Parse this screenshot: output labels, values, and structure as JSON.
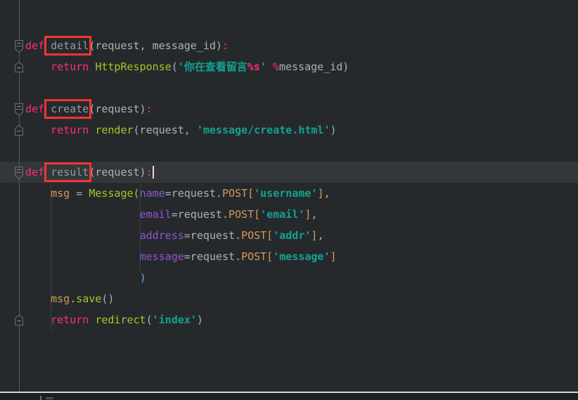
{
  "app": {
    "type": "code-editor",
    "description": "Dark-theme Python editor showing Django view functions with red annotation boxes"
  },
  "palette": {
    "background": "#26292c",
    "current_line_highlight": "#333739",
    "keyword_pink": "#fb2e77",
    "function_call_green": "#a3c724",
    "string_teal": "#12a391",
    "definition_name_grey": "#939ba1",
    "plain_text_grey": "#a9b2ba",
    "parameter_purple": "#9254d2",
    "property_orange": "#d79856",
    "paren_blue": "#6ba8e5",
    "annotation_box_red": "#f23434",
    "gutter_line_grey": "#56594f",
    "divider_light": "#d2d2d2"
  },
  "gutter": {
    "fold_icons": [
      {
        "line": 1,
        "icon": "fold-collapse-start-icon"
      },
      {
        "line": 2,
        "icon": "fold-collapse-end-icon"
      },
      {
        "line": 4,
        "icon": "fold-collapse-start-icon"
      },
      {
        "line": 5,
        "icon": "fold-collapse-end-icon"
      },
      {
        "line": 7,
        "icon": "fold-collapse-start-icon"
      },
      {
        "line": 14,
        "icon": "fold-collapse-end-icon"
      }
    ]
  },
  "annotations": {
    "red_boxed_words": [
      "detail",
      "create",
      "result"
    ],
    "caret_after_text": "def result(request):"
  },
  "code": {
    "language": "python",
    "lines": [
      {
        "tokens": [
          {
            "c": "kw",
            "t": "def"
          },
          {
            "c": "plain",
            "t": " "
          },
          {
            "c": "defname",
            "t": "detail"
          },
          {
            "c": "plain",
            "t": "(request, message_id)"
          },
          {
            "c": "kw",
            "t": ":"
          }
        ]
      },
      {
        "tokens": [
          {
            "c": "plain",
            "t": "    "
          },
          {
            "c": "kw",
            "t": "return"
          },
          {
            "c": "plain",
            "t": " "
          },
          {
            "c": "fn",
            "t": "HttpResponse"
          },
          {
            "c": "plain",
            "t": "("
          },
          {
            "c": "str",
            "t": "'你在查看留言"
          },
          {
            "c": "fmt",
            "t": "%s"
          },
          {
            "c": "str",
            "t": "'"
          },
          {
            "c": "plain",
            "t": " "
          },
          {
            "c": "kw",
            "t": "%"
          },
          {
            "c": "plain",
            "t": "message_id)"
          }
        ]
      },
      {
        "tokens": []
      },
      {
        "tokens": [
          {
            "c": "kw",
            "t": "def"
          },
          {
            "c": "plain",
            "t": " "
          },
          {
            "c": "defname",
            "t": "create"
          },
          {
            "c": "plain",
            "t": "(request)"
          },
          {
            "c": "kw",
            "t": ":"
          }
        ]
      },
      {
        "tokens": [
          {
            "c": "plain",
            "t": "    "
          },
          {
            "c": "kw",
            "t": "return"
          },
          {
            "c": "plain",
            "t": " "
          },
          {
            "c": "fn",
            "t": "render"
          },
          {
            "c": "plain",
            "t": "(request, "
          },
          {
            "c": "str",
            "t": "'message/create.html'"
          },
          {
            "c": "plain",
            "t": ")"
          }
        ]
      },
      {
        "tokens": []
      },
      {
        "tokens": [
          {
            "c": "kw",
            "t": "def"
          },
          {
            "c": "plain",
            "t": " "
          },
          {
            "c": "defname",
            "t": "result"
          },
          {
            "c": "plain",
            "t": "(request)"
          },
          {
            "c": "kw",
            "t": ":"
          }
        ]
      },
      {
        "tokens": [
          {
            "c": "plain",
            "t": "    "
          },
          {
            "c": "var",
            "t": "msg"
          },
          {
            "c": "plain",
            "t": " = "
          },
          {
            "c": "fn",
            "t": "Message("
          },
          {
            "c": "param",
            "t": "name"
          },
          {
            "c": "plain",
            "t": "=request."
          },
          {
            "c": "orange",
            "t": "POST["
          },
          {
            "c": "str",
            "t": "'username'"
          },
          {
            "c": "orange",
            "t": "]"
          },
          {
            "c": "plain",
            "t": ","
          }
        ]
      },
      {
        "tokens": [
          {
            "c": "plain",
            "t": "                  "
          },
          {
            "c": "param",
            "t": "email"
          },
          {
            "c": "plain",
            "t": "=request."
          },
          {
            "c": "orange",
            "t": "POST["
          },
          {
            "c": "str",
            "t": "'email'"
          },
          {
            "c": "orange",
            "t": "]"
          },
          {
            "c": "plain",
            "t": ","
          }
        ]
      },
      {
        "tokens": [
          {
            "c": "plain",
            "t": "                  "
          },
          {
            "c": "param",
            "t": "address"
          },
          {
            "c": "plain",
            "t": "=request."
          },
          {
            "c": "orange",
            "t": "POST["
          },
          {
            "c": "str",
            "t": "'addr'"
          },
          {
            "c": "orange",
            "t": "]"
          },
          {
            "c": "plain",
            "t": ","
          }
        ]
      },
      {
        "tokens": [
          {
            "c": "plain",
            "t": "                  "
          },
          {
            "c": "param",
            "t": "message"
          },
          {
            "c": "plain",
            "t": "=request."
          },
          {
            "c": "orange",
            "t": "POST["
          },
          {
            "c": "str",
            "t": "'message'"
          },
          {
            "c": "orange",
            "t": "]"
          }
        ]
      },
      {
        "tokens": [
          {
            "c": "plain",
            "t": "                  "
          },
          {
            "c": "blue",
            "t": ")"
          }
        ]
      },
      {
        "tokens": [
          {
            "c": "plain",
            "t": "    "
          },
          {
            "c": "var",
            "t": "msg"
          },
          {
            "c": "plain",
            "t": "."
          },
          {
            "c": "fn",
            "t": "save"
          },
          {
            "c": "plain",
            "t": "()"
          }
        ]
      },
      {
        "tokens": [
          {
            "c": "plain",
            "t": "    "
          },
          {
            "c": "kw",
            "t": "return"
          },
          {
            "c": "plain",
            "t": " "
          },
          {
            "c": "fn",
            "t": "redirect"
          },
          {
            "c": "plain",
            "t": "("
          },
          {
            "c": "str",
            "t": "'index'"
          },
          {
            "c": "plain",
            "t": ")"
          }
        ]
      }
    ]
  }
}
